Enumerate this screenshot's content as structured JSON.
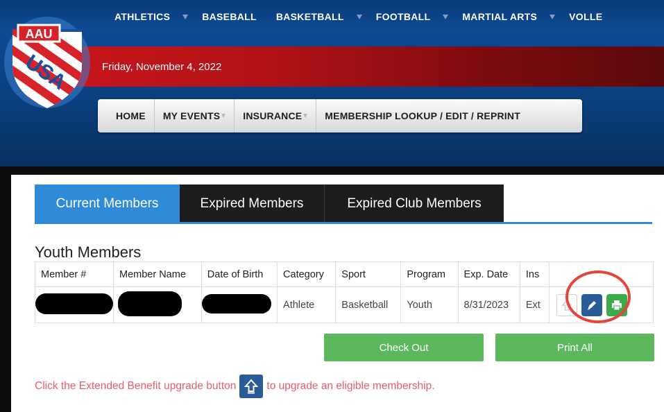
{
  "header": {
    "top_nav": [
      "ATHLETICS",
      "BASEBALL",
      "BASKETBALL",
      "FOOTBALL",
      "MARTIAL ARTS",
      "VOLLE"
    ],
    "date": "Friday, November 4, 2022",
    "logo": {
      "line1": "AAU",
      "line2": "USA"
    },
    "main_nav": [
      "HOME",
      "MY EVENTS",
      "INSURANCE",
      "MEMBERSHIP LOOKUP / EDIT / REPRINT"
    ]
  },
  "tabs": [
    "Current Members",
    "Expired Members",
    "Expired Club Members"
  ],
  "section_title": "Youth Members",
  "table": {
    "columns": [
      "Member #",
      "Member Name",
      "Date of Birth",
      "Category",
      "Sport",
      "Program",
      "Exp. Date",
      "Ins"
    ],
    "rows": [
      {
        "category": "Athlete",
        "sport": "Basketball",
        "program": "Youth",
        "exp_date": "8/31/2023",
        "ins": "Ext"
      }
    ]
  },
  "buttons": {
    "check_out": "Check Out",
    "print_all": "Print All"
  },
  "notice": {
    "before": "Click the Extended Benefit upgrade button",
    "after": "to upgrade an eligible membership."
  },
  "colors": {
    "header_blue": "#0c4a93",
    "date_red": "#c8161c",
    "tab_active": "#2f8ad8",
    "tab_dark": "#1d1d1d",
    "button_green": "#5cb85c",
    "edit_blue": "#2b5c9a",
    "notice_red": "#e35e6a",
    "highlight": "#e2453a"
  },
  "icons": [
    "upgrade-arrow-icon",
    "edit-pencil-icon",
    "print-icon",
    "dropdown-caret-icon"
  ]
}
